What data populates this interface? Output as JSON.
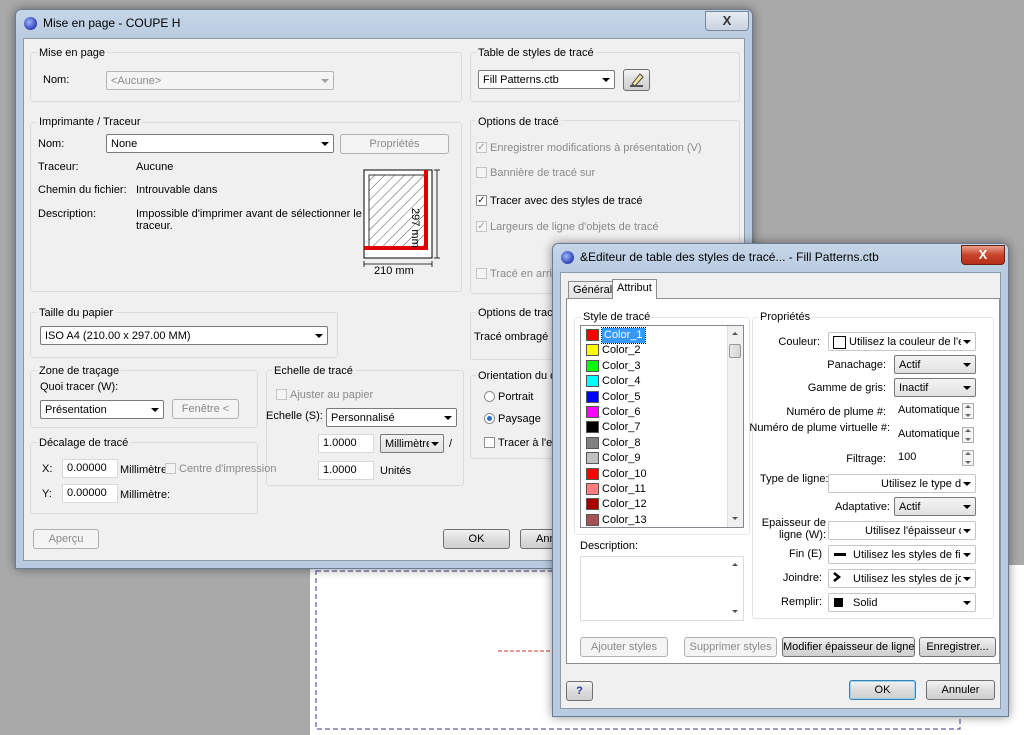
{
  "page_setup": {
    "title": "Mise en page - COUPE H",
    "close": "X",
    "mise_en_page": {
      "title": "Mise en page",
      "nom_label": "Nom:",
      "nom_value": "<Aucune>"
    },
    "style_table": {
      "title": "Table de styles de tracé",
      "value": "Fill Patterns.ctb"
    },
    "printer": {
      "title": "Imprimante / Traceur",
      "nom_label": "Nom:",
      "nom_value": "None",
      "properties_button": "Propriétés",
      "traceur_label": "Traceur:",
      "traceur_value": "Aucune",
      "chemin_label": "Chemin du fichier:",
      "chemin_value": "Introuvable dans",
      "description_label": "Description:",
      "description_value_1": "Impossible d'imprimer avant de sélectionner le",
      "description_value_2": "traceur.",
      "paper_height": "297 mm",
      "paper_width": "210 mm"
    },
    "plot_options": {
      "title": "Options de tracé",
      "opt1": "Enregistrer modifications à présentation (V)",
      "opt2": "Bannière de tracé sur",
      "opt3": "Tracer avec des styles de tracé",
      "opt4": "Largeurs de ligne d'objets de tracé",
      "opt5": "Tracé en arriè"
    },
    "shaded": {
      "title": "Options de tracé",
      "label": "Tracé ombragé (D"
    },
    "paper_size": {
      "title": "Taille du papier",
      "value": "ISO A4 (210.00 x 297.00 MM)"
    },
    "plot_area": {
      "title": "Zone de traçage",
      "what_label": "Quoi tracer (W):",
      "what_value": "Présentation",
      "window_button": "Fenêtre <"
    },
    "scale": {
      "title": "Echelle de tracé",
      "fit_label": "Ajuster au papier",
      "scale_label": "Echelle (S):",
      "scale_value": "Personnalisé",
      "value1": "1.0000",
      "unit1": "Millimètres",
      "slash": "/",
      "value2": "1.0000",
      "unit2": "Unités"
    },
    "offset": {
      "title": "Décalage de tracé",
      "x_label": "X:",
      "x_value": "0.00000",
      "x_unit": "Millimètre:",
      "center_label": "Centre d'impression",
      "y_label": "Y:",
      "y_value": "0.00000",
      "y_unit": "Millimètre:"
    },
    "orientation": {
      "title": "Orientation du de",
      "portrait": "Portrait",
      "paysage": "Paysage",
      "reverse": "Tracer à l'en"
    },
    "buttons": {
      "preview": "Aperçu",
      "ok": "OK",
      "cancel": "Ann"
    }
  },
  "editor": {
    "title": "&Editeur de table des styles de tracé... - Fill Patterns.ctb",
    "close": "X",
    "tabs": {
      "general": "Général",
      "attribut": "Attribut"
    },
    "style_list_title": "Style de tracé",
    "styles": [
      {
        "name": "Color_1",
        "color": "#ff0000"
      },
      {
        "name": "Color_2",
        "color": "#ffff00"
      },
      {
        "name": "Color_3",
        "color": "#00ff00"
      },
      {
        "name": "Color_4",
        "color": "#00ffff"
      },
      {
        "name": "Color_5",
        "color": "#0000ff"
      },
      {
        "name": "Color_6",
        "color": "#ff00ff"
      },
      {
        "name": "Color_7",
        "color": "#000000"
      },
      {
        "name": "Color_8",
        "color": "#808080"
      },
      {
        "name": "Color_9",
        "color": "#c0c0c0"
      },
      {
        "name": "Color_10",
        "color": "#ff0000"
      },
      {
        "name": "Color_11",
        "color": "#ff7f7f"
      },
      {
        "name": "Color_12",
        "color": "#a50000"
      },
      {
        "name": "Color_13",
        "color": "#a55252"
      }
    ],
    "description_title": "Description:",
    "properties": {
      "title": "Propriétés",
      "couleur_label": "Couleur:",
      "couleur_value": "Utilisez la couleur de l'enti",
      "panachage_label": "Panachage:",
      "panachage_value": "Actif",
      "gris_label": "Gamme de gris:",
      "gris_value": "Inactif",
      "plume_label": "Numéro de plume #:",
      "plume_value": "Automatique",
      "plume_virt_label": "Numéro de plume virtuelle #:",
      "plume_virt_value": "Automatique",
      "filtrage_label": "Filtrage:",
      "filtrage_value": "100",
      "type_label": "Type de ligne:",
      "type_value": "Utilisez le type de",
      "adaptative_label": "Adaptative:",
      "adaptative_value": "Actif",
      "epaisseur_label_1": "Epaisseur de",
      "epaisseur_label_2": "ligne (W):",
      "epaisseur_value": "Utilisez l'épaisseur de",
      "fin_label": "Fin (E)",
      "fin_value": "Utilisez les styles de fin c",
      "joindre_label": "Joindre:",
      "joindre_value": "Utilisez les styles de jointe",
      "remplir_label": "Remplir:",
      "remplir_value": "Solid"
    },
    "buttons": {
      "add": "Ajouter styles",
      "delete": "Supprimer styles",
      "modify": "Modifier épaisseur de ligne",
      "save": "Enregistrer...",
      "help": "?",
      "ok": "OK",
      "cancel": "Annuler"
    }
  }
}
